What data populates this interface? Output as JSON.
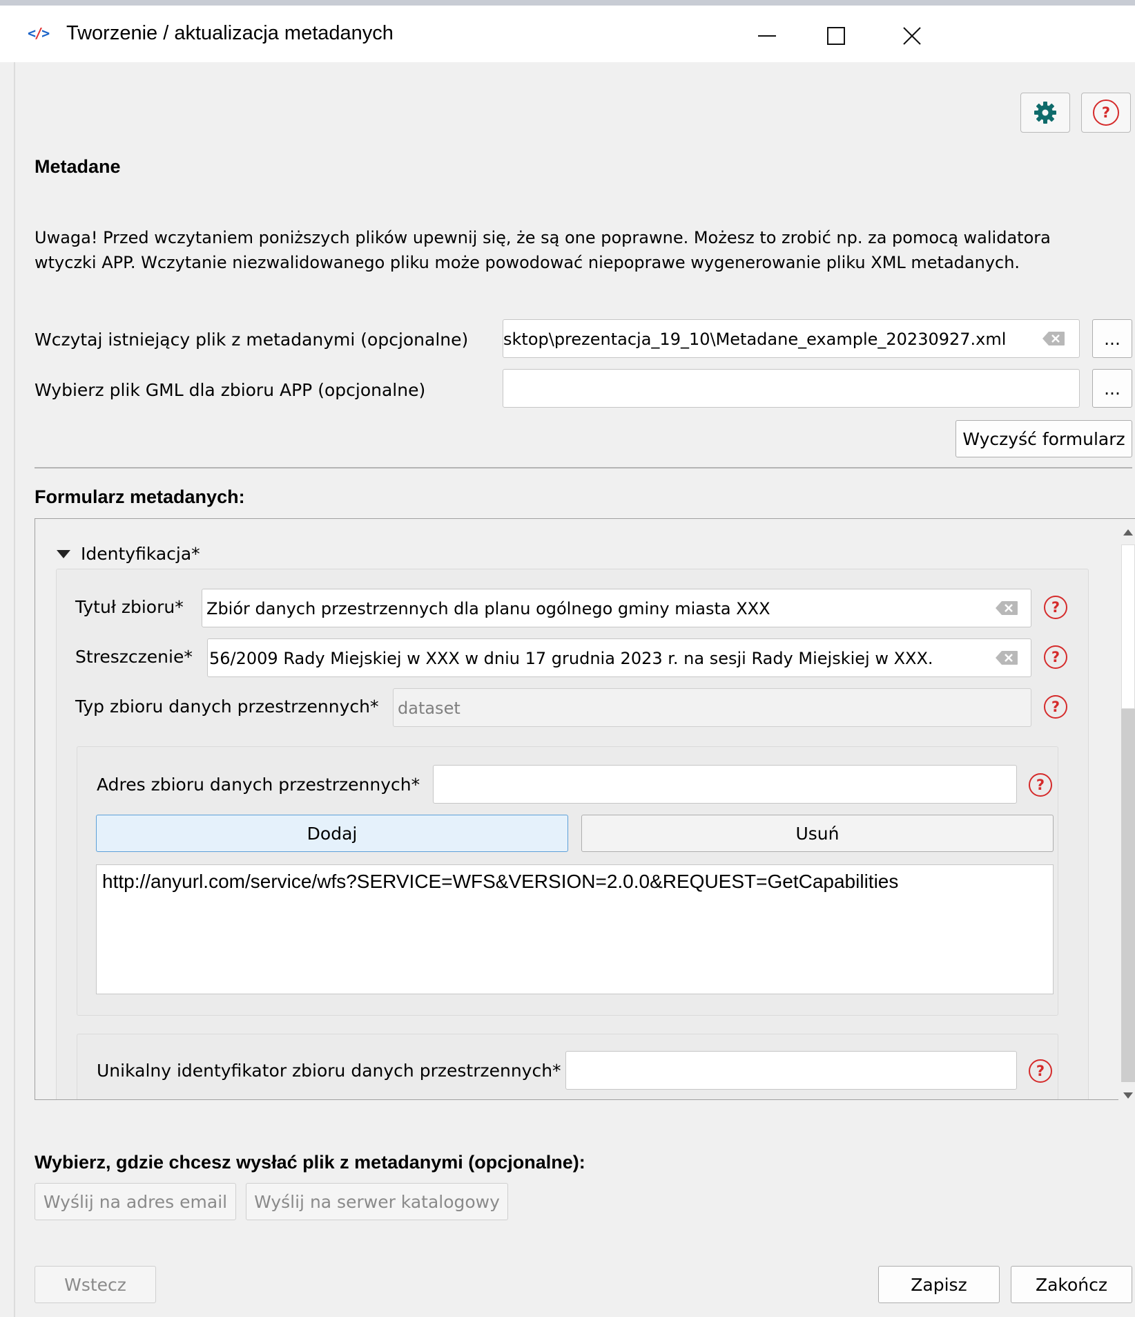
{
  "window": {
    "title": "Tworzenie / aktualizacja metadanych",
    "icon": "</>",
    "controls": [
      "—",
      "☐",
      "✕"
    ]
  },
  "toolbar": {
    "settings_icon": "gear-icon",
    "help_icon": "help-icon",
    "help_glyph": "?"
  },
  "section": {
    "metadane_heading": "Metadane",
    "warning_line1": "Uwaga! Przed wczytaniem poniższych plików upewnij się, że są one poprawne. Możesz to zrobić np. za pomocą walidatora",
    "warning_line2": "wtyczki APP. Wczytanie niezwalidowanego pliku może powodować niepoprawe wygenerowanie pliku XML metadanych."
  },
  "files": {
    "load_label": "Wczytaj istniejący plik z metadanymi (opcjonalne)",
    "load_value": "sktop\\prezentacja_19_10\\Metadane_example_20230927.xml",
    "gml_label": "Wybierz plik GML dla zbioru APP (opcjonalne)",
    "gml_value": "",
    "browse": "...",
    "clear_form": "Wyczyść formularz"
  },
  "form": {
    "heading": "Formularz metadanych:",
    "group_title": "Identyfikacja*",
    "title_label": "Tytuł zbioru*",
    "title_value": "Zbiór danych przestrzennych dla planu ogólnego gminy miasta XXX",
    "abstract_label": "Streszczenie*",
    "abstract_value": "56/2009 Rady Miejskiej w XXX w dniu 17 grudnia 2023 r. na sesji Rady Miejskiej w XXX.",
    "type_label": "Typ zbioru danych przestrzennych*",
    "type_value": "dataset",
    "address_label": "Adres zbioru danych przestrzennych*",
    "address_value": "",
    "add_button": "Dodaj",
    "remove_button": "Usuń",
    "address_list": [
      "http://anyurl.com/service/wfs?SERVICE=WFS&VERSION=2.0.0&REQUEST=GetCapabilities"
    ],
    "uid_label": "Unikalny identyfikator zbioru danych przestrzennych*",
    "uid_value": ""
  },
  "send": {
    "heading": "Wybierz, gdzie chcesz wysłać plik z metadanymi (opcjonalne):",
    "email_button": "Wyślij na adres email",
    "server_button": "Wyślij na serwer katalogowy"
  },
  "footer": {
    "back": "Wstecz",
    "save": "Zapisz",
    "finish": "Zakończ"
  },
  "colors": {
    "help_red": "#d52b2b",
    "settings_teal": "#0f6b6b",
    "add_button_bg": "#e5f1fb",
    "add_button_border": "#5c9fd8"
  }
}
